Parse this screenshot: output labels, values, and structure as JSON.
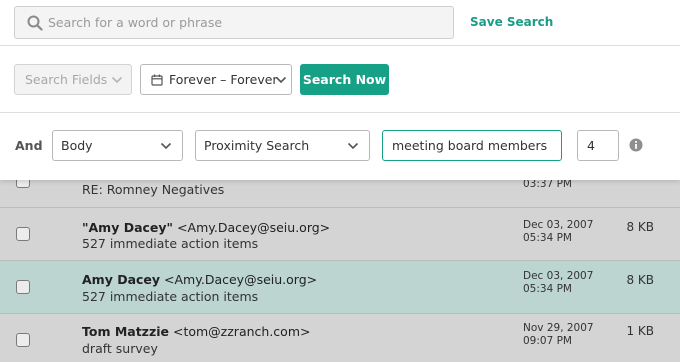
{
  "search": {
    "placeholder": "Search for a word or phrase",
    "save_label": "Save Search"
  },
  "filters": {
    "fields_label": "Search Fields",
    "date_range_label": "Forever – Forever",
    "search_now_label": "Search Now"
  },
  "proximity": {
    "conjunction_label": "And",
    "field_value": "Body",
    "mode_value": "Proximity Search",
    "terms_value": "meeting board members",
    "distance_value": "4"
  },
  "emails": [
    {
      "sender_name": "",
      "sender_email": "",
      "subject": "RE: Romney Negatives",
      "date": "",
      "time": "03:37 PM",
      "size": "",
      "selected": false
    },
    {
      "sender_name": "\"Amy Dacey\"",
      "sender_email": "<Amy.Dacey@seiu.org>",
      "subject": "527 immediate action items",
      "date": "Dec 03, 2007",
      "time": "05:34 PM",
      "size": "8 KB",
      "selected": false
    },
    {
      "sender_name": "Amy Dacey",
      "sender_email": "<Amy.Dacey@seiu.org>",
      "subject": "527 immediate action items",
      "date": "Dec 03, 2007",
      "time": "05:34 PM",
      "size": "8 KB",
      "selected": true
    },
    {
      "sender_name": "Tom Matzzie",
      "sender_email": "<tom@zzranch.com>",
      "subject": "draft survey",
      "date": "Nov 29, 2007",
      "time": "09:07 PM",
      "size": "1 KB",
      "selected": false
    }
  ],
  "colors": {
    "accent": "#16a085",
    "selected_row": "#bcd5d1",
    "list_background": "#d4d4d4"
  },
  "icons": [
    "search-icon",
    "chevron-down-icon",
    "calendar-icon",
    "info-icon"
  ]
}
